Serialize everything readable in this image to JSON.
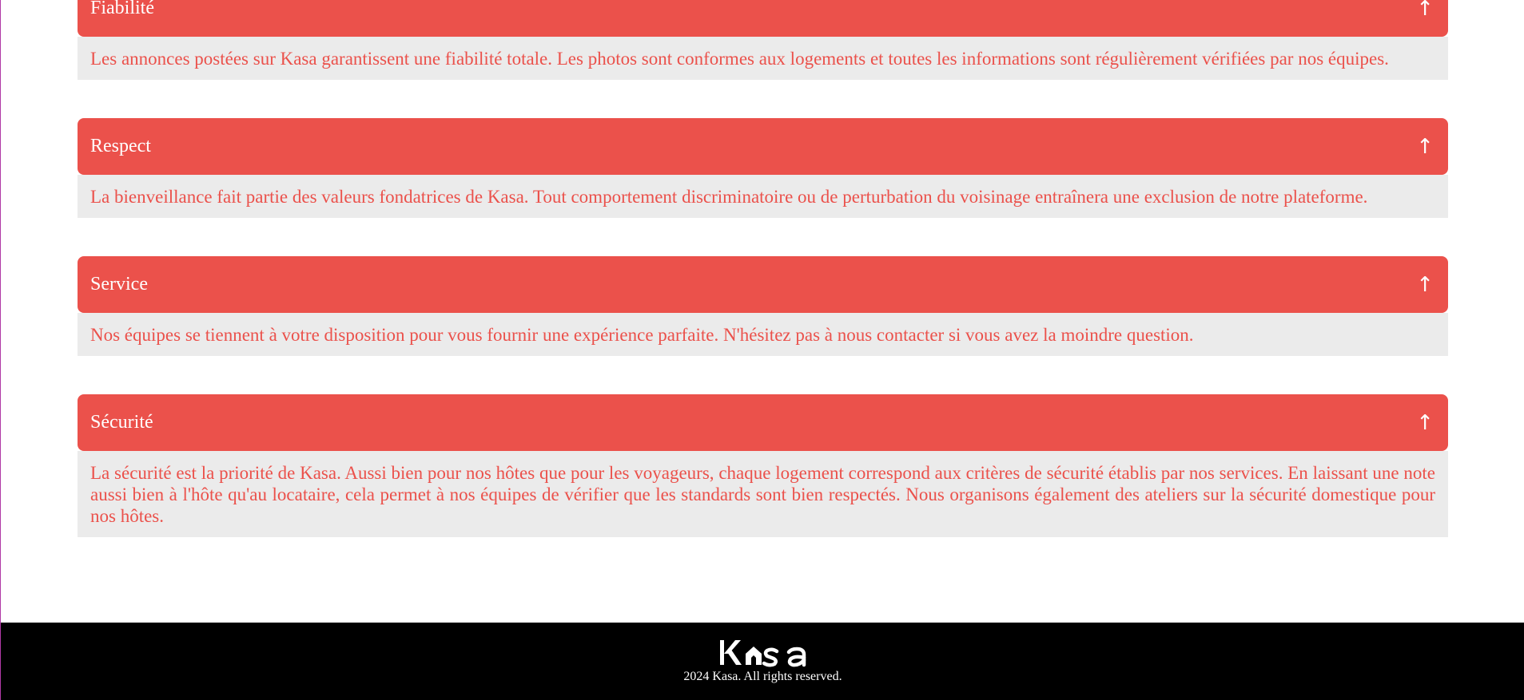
{
  "accordions": [
    {
      "title": "Fiabilité",
      "arrow": "↑",
      "content": "Les annonces postées sur Kasa garantissent une fiabilité totale. Les photos sont conformes aux logements et toutes les informations sont régulièrement vérifiées par nos équipes."
    },
    {
      "title": "Respect",
      "arrow": "↑",
      "content": "La bienveillance fait partie des valeurs fondatrices de Kasa. Tout comportement discriminatoire ou de perturbation du voisinage entraînera une exclusion de notre plateforme."
    },
    {
      "title": "Service",
      "arrow": "↑",
      "content": "Nos équipes se tiennent à votre disposition pour vous fournir une expérience parfaite. N'hésitez pas à nous contacter si vous avez la moindre question."
    },
    {
      "title": "Sécurité",
      "arrow": "↑",
      "content": "La sécurité est la priorité de Kasa. Aussi bien pour nos hôtes que pour les voyageurs, chaque logement correspond aux critères de sécurité établis par nos services. En laissant une note aussi bien à l'hôte qu'au locataire, cela permet à nos équipes de vérifier que les standards sont bien respectés. Nous organisons également des ateliers sur la sécurité domestique pour nos hôtes."
    }
  ],
  "footer": {
    "logo_text": "Kasa",
    "copyright": "2024 Kasa. All rights reserved."
  },
  "colors": {
    "accent": "#eb514b",
    "panel_bg": "#ebebeb",
    "footer_bg": "#000000"
  }
}
